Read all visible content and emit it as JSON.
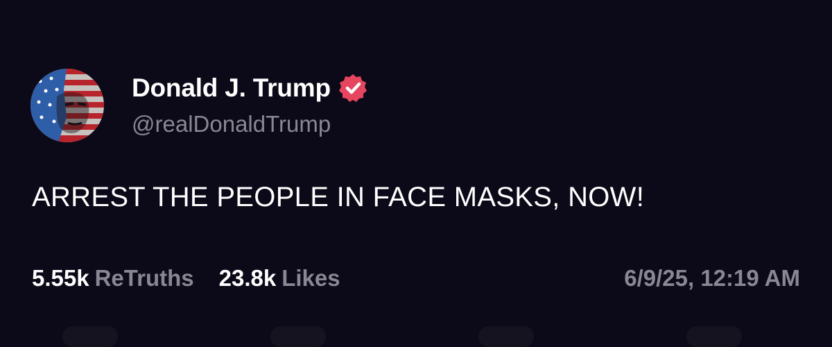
{
  "author": {
    "display_name": "Donald J. Trump",
    "handle": "@realDonaldTrump",
    "verified_color": "#e5455e"
  },
  "post": {
    "text": "ARREST THE PEOPLE IN FACE MASKS, NOW!",
    "retruths_count": "5.55k",
    "retruths_label": "ReTruths",
    "likes_count": "23.8k",
    "likes_label": "Likes",
    "timestamp": "6/9/25, 12:19 AM"
  },
  "theme": {
    "background": "#0c0a18",
    "primary_text": "#ffffff",
    "secondary_text": "#8a8794"
  },
  "icons": {
    "avatar": "flag-portrait-avatar",
    "verified": "verified-badge-icon"
  }
}
